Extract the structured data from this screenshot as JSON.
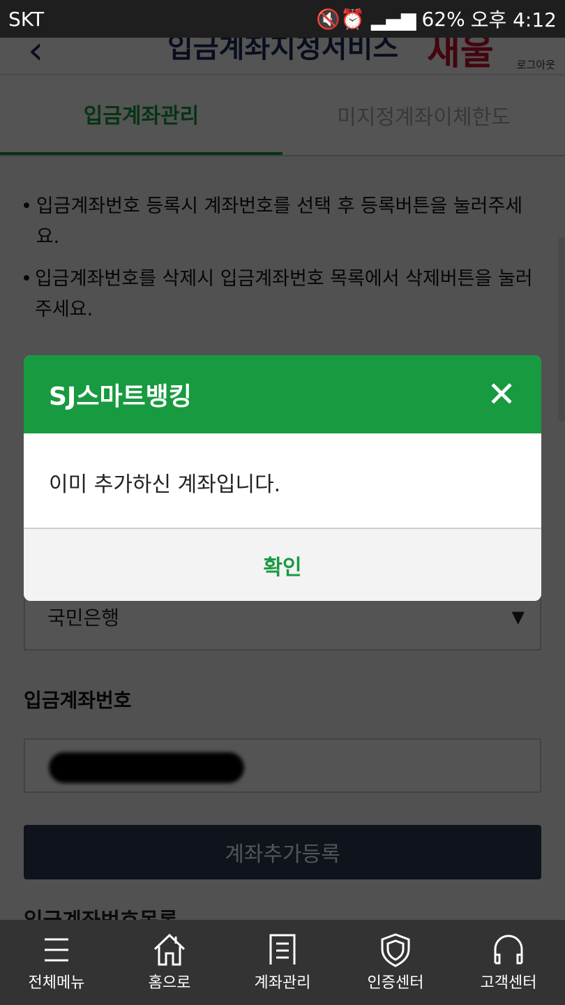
{
  "status": {
    "carrier": "SKT",
    "battery": "62%",
    "time": "오후 4:12"
  },
  "header": {
    "title": "입금계좌지정서비스",
    "logo": "새울",
    "logout": "로그아웃"
  },
  "tabs": [
    {
      "label": "입금계좌관리",
      "active": true
    },
    {
      "label": "미지정계좌이체한도",
      "active": false
    }
  ],
  "notes": [
    "입금계좌번호 등록시 계좌번호를 선택 후 등록버튼을 눌러주세요.",
    "입금계좌번호를 삭제시 입금계좌번호 목록에서 삭제버튼을 눌러주세요."
  ],
  "form": {
    "bank_value": "국민은행",
    "account_label": "입금계좌번호",
    "add_button": "계좌추가등록",
    "list_title": "입금계좌번호목록"
  },
  "dialog": {
    "title": "SJ스마트뱅킹",
    "message": "이미 추가하신 계좌입니다.",
    "confirm": "확인"
  },
  "nav": [
    {
      "label": "전체메뉴",
      "icon": "menu-icon"
    },
    {
      "label": "홈으로",
      "icon": "home-icon"
    },
    {
      "label": "계좌관리",
      "icon": "document-icon"
    },
    {
      "label": "인증센터",
      "icon": "shield-icon"
    },
    {
      "label": "고객센터",
      "icon": "headset-icon"
    }
  ],
  "colors": {
    "accent": "#189a40",
    "button": "#2a3a55"
  }
}
